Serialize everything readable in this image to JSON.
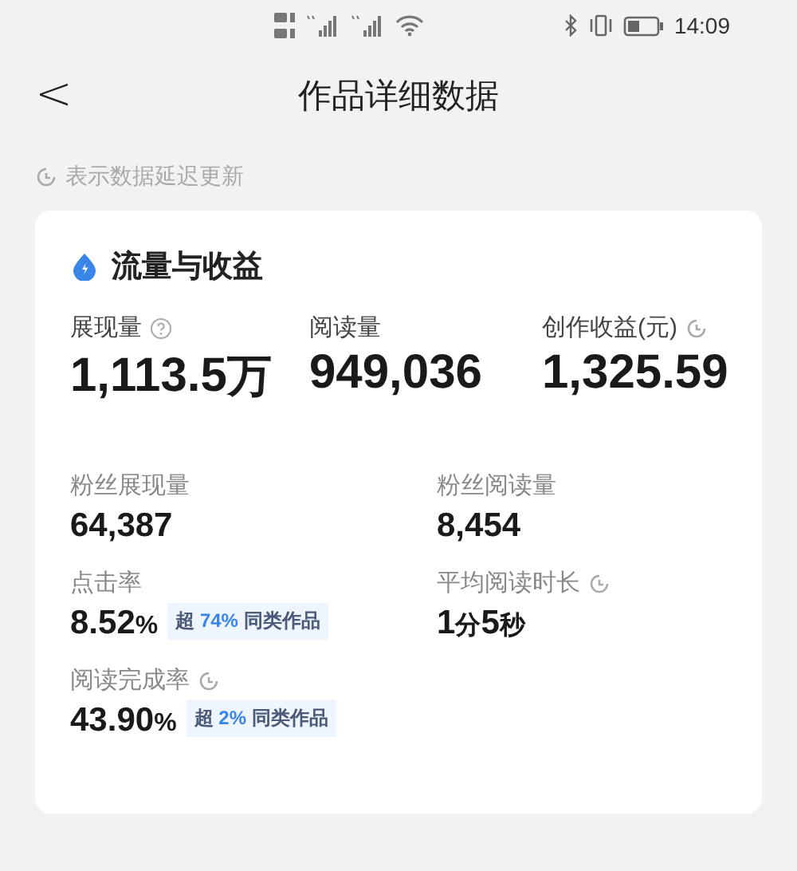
{
  "status_bar": {
    "time": "14:09"
  },
  "header": {
    "title": "作品详细数据",
    "back": "<"
  },
  "note": "表示数据延迟更新",
  "card": {
    "title": "流量与收益",
    "top_metrics": [
      {
        "label": "展现量",
        "kind": "help",
        "parts": [
          {
            "text": "1,113.5",
            "kind": "num"
          },
          {
            "text": "万",
            "kind": "unit"
          }
        ]
      },
      {
        "label": "阅读量",
        "kind": "plain",
        "parts": [
          {
            "text": "949,036",
            "kind": "num"
          }
        ]
      },
      {
        "label": "创作收益(元)",
        "kind": "delayed",
        "parts": [
          {
            "text": "1,325.59",
            "kind": "num"
          }
        ]
      }
    ],
    "metrics": [
      {
        "label": "粉丝展现量",
        "kind": "plain",
        "parts": [
          {
            "text": "64,387",
            "kind": "num"
          }
        ]
      },
      {
        "label": "粉丝阅读量",
        "kind": "plain",
        "parts": [
          {
            "text": "8,454",
            "kind": "num"
          }
        ]
      },
      {
        "label": "点击率",
        "kind": "plain",
        "parts": [
          {
            "text": "8.52",
            "kind": "num"
          },
          {
            "text": "%",
            "kind": "unit"
          }
        ],
        "badge": {
          "prefix": "超",
          "highlight": "74%",
          "suffix": "同类作品"
        }
      },
      {
        "label": "平均阅读时长",
        "kind": "delayed",
        "parts": [
          {
            "text": "1",
            "kind": "num"
          },
          {
            "text": "分",
            "kind": "unit"
          },
          {
            "text": "5",
            "kind": "num"
          },
          {
            "text": "秒",
            "kind": "unit"
          }
        ]
      },
      {
        "label": "阅读完成率",
        "kind": "delayed",
        "parts": [
          {
            "text": "43.90",
            "kind": "num"
          },
          {
            "text": "%",
            "kind": "unit"
          }
        ],
        "badge": {
          "prefix": "超",
          "highlight": "2%",
          "suffix": "同类作品"
        }
      }
    ]
  }
}
